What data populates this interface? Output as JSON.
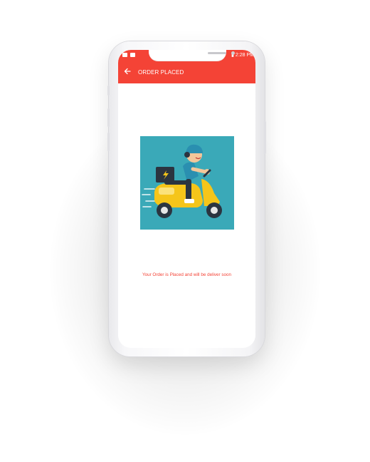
{
  "status_bar": {
    "time": "2:28 PM"
  },
  "app_bar": {
    "back_icon": "arrow-left-icon",
    "title": "ORDER PLACED"
  },
  "illustration": {
    "icon": "delivery-scooter-illustration"
  },
  "message": "Your Order is Placed and will be deliver soon",
  "colors": {
    "accent": "#f44336",
    "illustration_bg": "#3aa9b8",
    "scooter": "#f5c51a"
  }
}
